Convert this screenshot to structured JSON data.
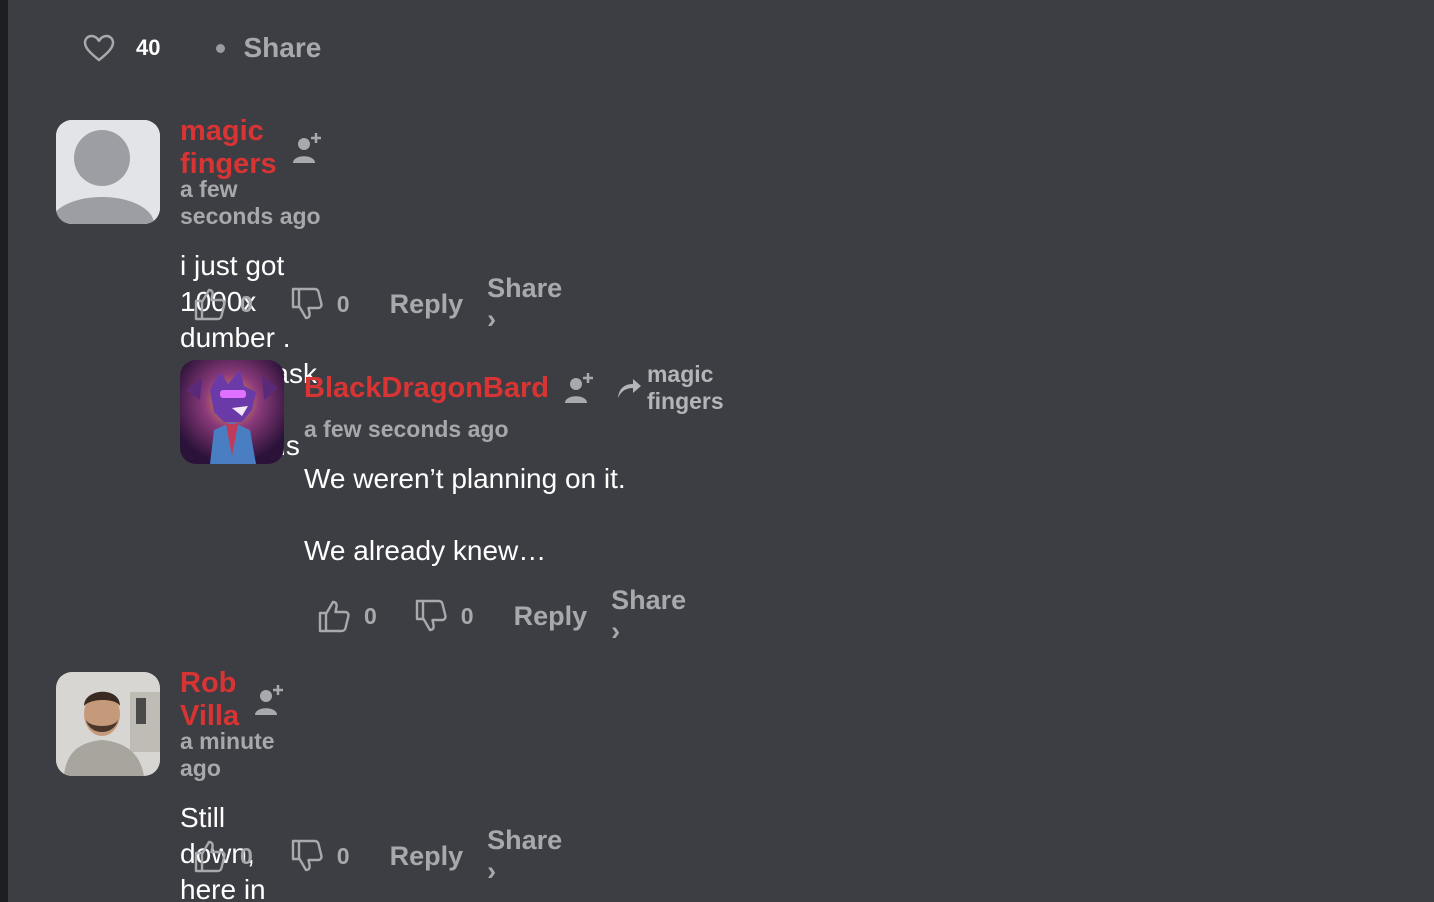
{
  "top_bar": {
    "like_count": "40",
    "share_label": "Share"
  },
  "comments": [
    {
      "username": "magic fingers",
      "timestamp": "a few seconds ago",
      "text": [
        "i just got 1000x dumber . no one ask me any questions"
      ],
      "likes": "0",
      "dislikes": "0",
      "reply_label": "Reply",
      "share_label": "Share ›",
      "avatar": "default-avatar"
    },
    {
      "username": "BlackDragonBard",
      "reply_to": "magic fingers",
      "timestamp": "a few seconds ago",
      "text": [
        "We weren’t planning on it.",
        "We already knew…"
      ],
      "likes": "0",
      "dislikes": "0",
      "reply_label": "Reply",
      "share_label": "Share ›",
      "avatar": "dragon-avatar"
    },
    {
      "username": "Rob Villa",
      "timestamp": "a minute ago",
      "text": [
        "Still down, here in Dallas"
      ],
      "likes": "0",
      "dislikes": "0",
      "reply_label": "Reply",
      "share_label": "Share ›",
      "avatar": "photo-avatar"
    }
  ],
  "colors": {
    "background": "#3d3e43",
    "username": "#d93434",
    "muted_text": "#a8a9ad",
    "body_text": "#ffffff"
  }
}
